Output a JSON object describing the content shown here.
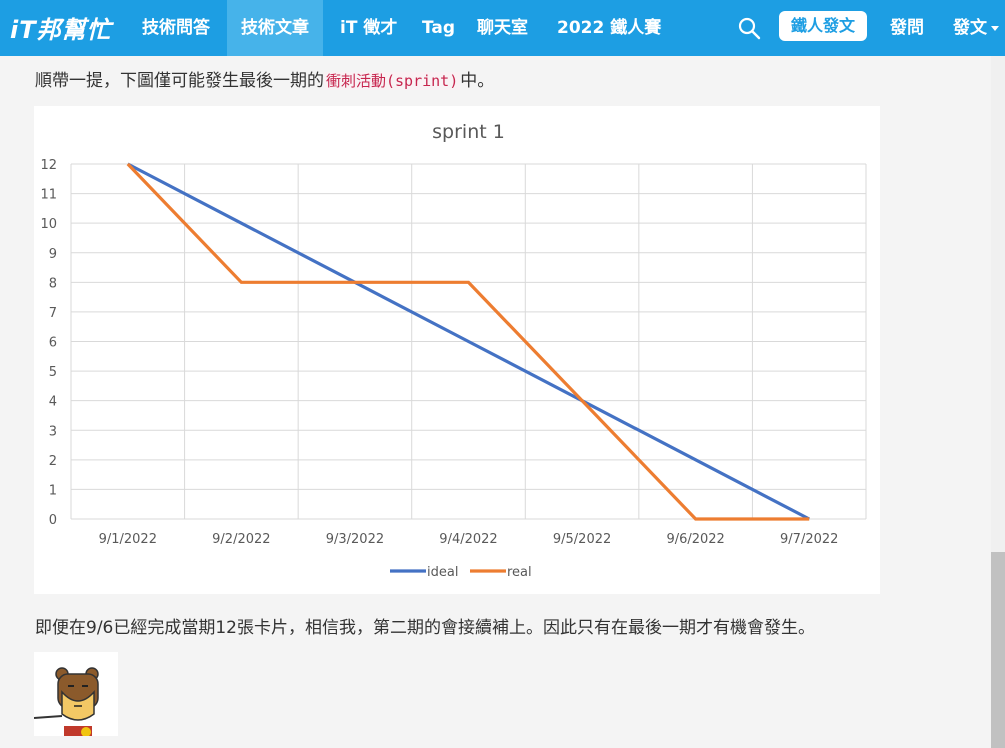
{
  "nav": {
    "logo": "iT邦幫忙",
    "items": [
      "技術問答",
      "技術文章",
      "iT 徵才",
      "Tag",
      "聊天室",
      "2022 鐵人賽"
    ],
    "post_button": "鐵人發文",
    "ask": "發問",
    "publish": "發文"
  },
  "article": {
    "para1_before": "順帶一提，下圖僅可能發生最後一期的",
    "para1_code": "衝刺活動(sprint)",
    "para1_after": "中。",
    "para2": "即便在9/6已經完成當期12張卡片，相信我，第二期的會接續補上。因此只有在最後一期才有機會發生。"
  },
  "chart_data": {
    "type": "line",
    "title": "sprint 1",
    "categories": [
      "9/1/2022",
      "9/2/2022",
      "9/3/2022",
      "9/4/2022",
      "9/5/2022",
      "9/6/2022",
      "9/7/2022"
    ],
    "series": [
      {
        "name": "ideal",
        "values": [
          12,
          10,
          8,
          6,
          4,
          2,
          0
        ],
        "color": "#4472c4"
      },
      {
        "name": "real",
        "values": [
          12,
          8,
          8,
          8,
          4,
          0,
          0
        ],
        "color": "#ed7d31"
      }
    ],
    "ylim": [
      0,
      12
    ],
    "yticks": [
      0,
      1,
      2,
      3,
      4,
      5,
      6,
      7,
      8,
      9,
      10,
      11,
      12
    ],
    "grid": true,
    "legend": "bottom"
  }
}
